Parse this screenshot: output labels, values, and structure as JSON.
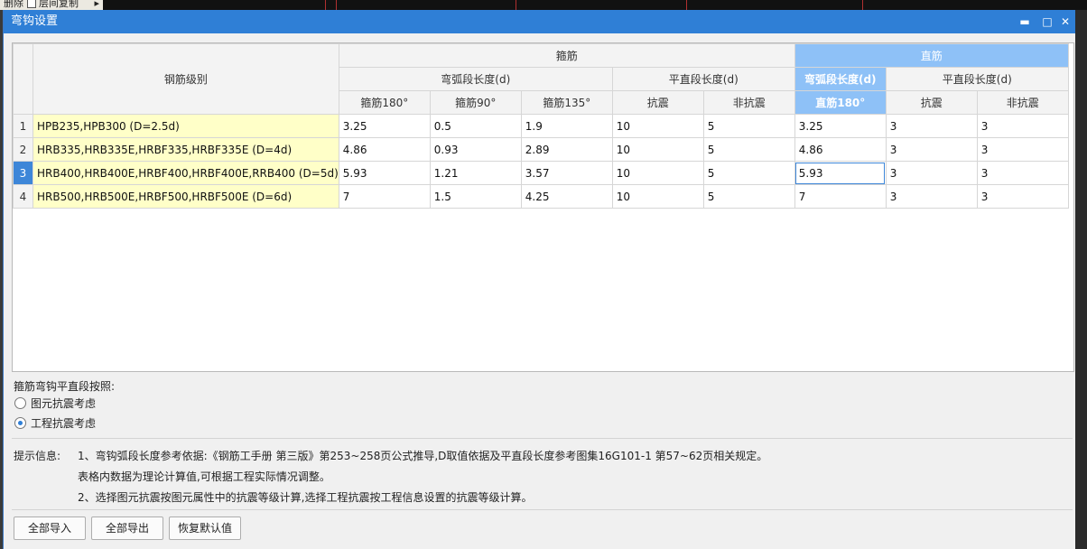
{
  "background": {
    "fragment_left": "删除",
    "fragment_copy": "层间复制",
    "fragment_arrow": "▸"
  },
  "dialog": {
    "title": "弯钩设置",
    "minimize": "▬",
    "maximize": "□",
    "close": "✕"
  },
  "grid": {
    "header": {
      "level": "钢筋级别",
      "stirrup": "箍筋",
      "straight": "直筋",
      "stirrup_arc": "弯弧段长度(d)",
      "stirrup_flat": "平直段长度(d)",
      "straight_arc": "弯弧段长度(d)",
      "straight_flat": "平直段长度(d)",
      "cols": [
        "箍筋180°",
        "箍筋90°",
        "箍筋135°",
        "抗震",
        "非抗震",
        "直筋180°",
        "抗震",
        "非抗震"
      ]
    },
    "rows": [
      {
        "no": "1",
        "level": "HPB235,HPB300 (D=2.5d)",
        "values": [
          "3.25",
          "0.5",
          "1.9",
          "10",
          "5",
          "3.25",
          "3",
          "3"
        ]
      },
      {
        "no": "2",
        "level": "HRB335,HRB335E,HRBF335,HRBF335E (D=4d)",
        "values": [
          "4.86",
          "0.93",
          "2.89",
          "10",
          "5",
          "4.86",
          "3",
          "3"
        ]
      },
      {
        "no": "3",
        "level": "HRB400,HRB400E,HRBF400,HRBF400E,RRB400 (D=5d)",
        "values": [
          "5.93",
          "1.21",
          "3.57",
          "10",
          "5",
          "5.93",
          "3",
          "3"
        ]
      },
      {
        "no": "4",
        "level": "HRB500,HRB500E,HRBF500,HRBF500E (D=6d)",
        "values": [
          "7",
          "1.5",
          "4.25",
          "10",
          "5",
          "7",
          "3",
          "3"
        ]
      }
    ],
    "selected_row": "3"
  },
  "options": {
    "label": "箍筋弯钩平直段按照:",
    "radio1": "图元抗震考虑",
    "radio2": "工程抗震考虑",
    "checked": "radio2"
  },
  "hints": {
    "label": "提示信息:",
    "line1": "1、弯钩弧段长度参考依据:《钢筋工手册 第三版》第253~258页公式推导,D取值依据及平直段长度参考图集16G101-1 第57~62页相关规定。",
    "line2": "表格内数据为理论计算值,可根据工程实际情况调整。",
    "line3": "2、选择图元抗震按图元属性中的抗震等级计算,选择工程抗震按工程信息设置的抗震等级计算。"
  },
  "buttons": {
    "import_all": "全部导入",
    "export_all": "全部导出",
    "restore_default": "恢复默认值"
  }
}
